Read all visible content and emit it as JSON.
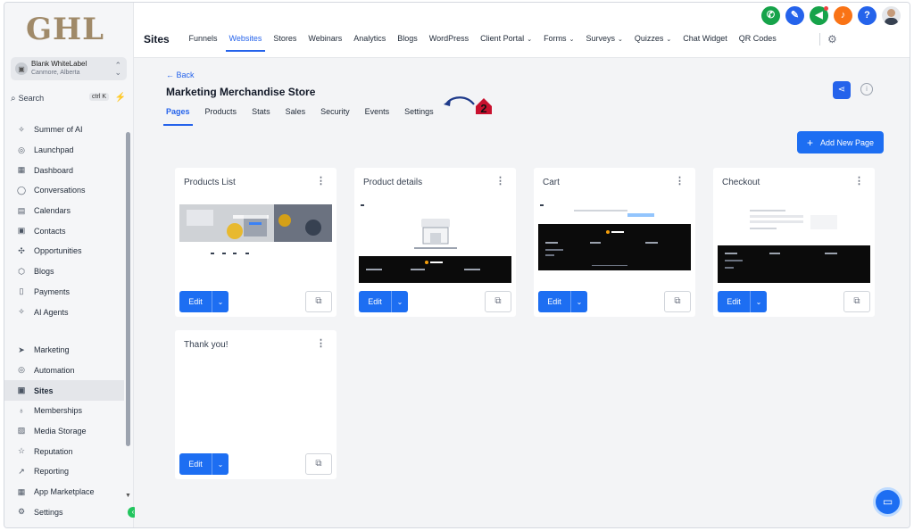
{
  "sidebar": {
    "logo": "GHL",
    "account": {
      "name": "Blank WhiteLabel",
      "location": "Canmore, Alberta"
    },
    "search": {
      "label": "Search",
      "shortcut": "ctrl K"
    },
    "items": [
      {
        "label": "Summer of AI",
        "icon": "sparkle-icon",
        "glyph": "✧"
      },
      {
        "label": "Launchpad",
        "icon": "rocket-icon",
        "glyph": "◎"
      },
      {
        "label": "Dashboard",
        "icon": "grid-icon",
        "glyph": "▦"
      },
      {
        "label": "Conversations",
        "icon": "chat-icon",
        "glyph": "◯"
      },
      {
        "label": "Calendars",
        "icon": "calendar-icon",
        "glyph": "▤"
      },
      {
        "label": "Contacts",
        "icon": "contacts-icon",
        "glyph": "▣"
      },
      {
        "label": "Opportunities",
        "icon": "opportunities-icon",
        "glyph": "✣"
      },
      {
        "label": "Blogs",
        "icon": "cube-icon",
        "glyph": "⬡"
      },
      {
        "label": "Payments",
        "icon": "receipt-icon",
        "glyph": "▯"
      },
      {
        "label": "AI Agents",
        "icon": "sparkle-icon",
        "glyph": "✧"
      }
    ],
    "items2": [
      {
        "label": "Marketing",
        "icon": "send-icon",
        "glyph": "➤"
      },
      {
        "label": "Automation",
        "icon": "automation-icon",
        "glyph": "◎"
      },
      {
        "label": "Sites",
        "icon": "sites-icon",
        "glyph": "▣",
        "active": true
      },
      {
        "label": "Memberships",
        "icon": "award-icon",
        "glyph": "♁"
      },
      {
        "label": "Media Storage",
        "icon": "image-icon",
        "glyph": "▨"
      },
      {
        "label": "Reputation",
        "icon": "star-icon",
        "glyph": "☆"
      },
      {
        "label": "Reporting",
        "icon": "chart-line-icon",
        "glyph": "↗"
      },
      {
        "label": "App Marketplace",
        "icon": "apps-icon",
        "glyph": "▦"
      },
      {
        "label": "Settings",
        "icon": "gear-icon",
        "glyph": "⚙"
      }
    ]
  },
  "topbar": {
    "section": "Sites",
    "nav": [
      {
        "label": "Funnels"
      },
      {
        "label": "Websites",
        "active": true
      },
      {
        "label": "Stores"
      },
      {
        "label": "Webinars"
      },
      {
        "label": "Analytics"
      },
      {
        "label": "Blogs"
      },
      {
        "label": "WordPress"
      },
      {
        "label": "Client Portal",
        "dropdown": true
      },
      {
        "label": "Forms",
        "dropdown": true
      },
      {
        "label": "Surveys",
        "dropdown": true
      },
      {
        "label": "Quizzes",
        "dropdown": true
      },
      {
        "label": "Chat Widget"
      },
      {
        "label": "QR Codes"
      }
    ],
    "icons": [
      {
        "name": "phone-icon",
        "glyph": "✆",
        "color": "#16a34a"
      },
      {
        "name": "magic-icon",
        "glyph": "✎",
        "color": "#2563eb"
      },
      {
        "name": "megaphone-icon",
        "glyph": "◀",
        "color": "#16a34a",
        "dot": true
      },
      {
        "name": "bell-icon",
        "glyph": "♪",
        "color": "#f97316"
      },
      {
        "name": "help-icon",
        "glyph": "?",
        "color": "#2563eb"
      }
    ]
  },
  "page": {
    "back": "← Back",
    "title": "Marketing Merchandise Store",
    "tabs": [
      {
        "label": "Pages",
        "active": true
      },
      {
        "label": "Products"
      },
      {
        "label": "Stats"
      },
      {
        "label": "Sales"
      },
      {
        "label": "Security"
      },
      {
        "label": "Events"
      },
      {
        "label": "Settings"
      }
    ],
    "annotation_number": "2",
    "add_button": "Add New Page",
    "edit_label": "Edit",
    "cards": [
      {
        "title": "Products List"
      },
      {
        "title": "Product details"
      },
      {
        "title": "Cart"
      },
      {
        "title": "Checkout"
      },
      {
        "title": "Thank you!"
      }
    ]
  },
  "colors": {
    "accent": "#1d6ef2",
    "logo": "#a08a69",
    "annotation": "#c8102e"
  }
}
